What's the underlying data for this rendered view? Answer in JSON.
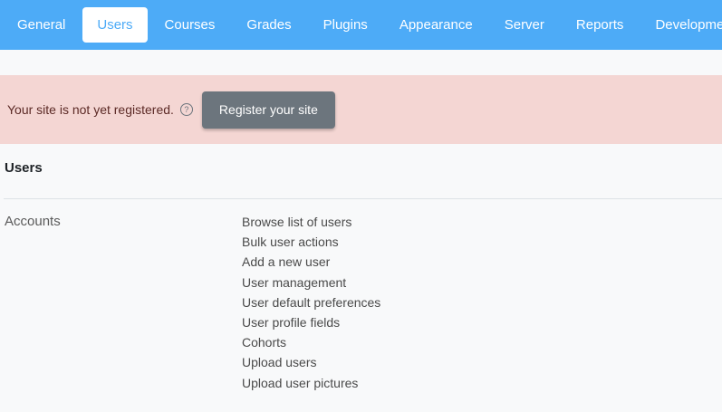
{
  "tabs": [
    "General",
    "Users",
    "Courses",
    "Grades",
    "Plugins",
    "Appearance",
    "Server",
    "Reports",
    "Development"
  ],
  "active_tab": "Users",
  "alert": {
    "message": "Your site is not yet registered.",
    "help_icon": "?",
    "button_label": "Register your site"
  },
  "section": {
    "title": "Users",
    "category": "Accounts",
    "links": [
      "Browse list of users",
      "Bulk user actions",
      "Add a new user",
      "User management",
      "User default preferences",
      "User profile fields",
      "Cohorts",
      "Upload users",
      "Upload user pictures"
    ]
  },
  "colors": {
    "tab_bar": "#4dabf7",
    "alert_bg": "#f4d6d3",
    "button_bg": "#6c757d"
  }
}
